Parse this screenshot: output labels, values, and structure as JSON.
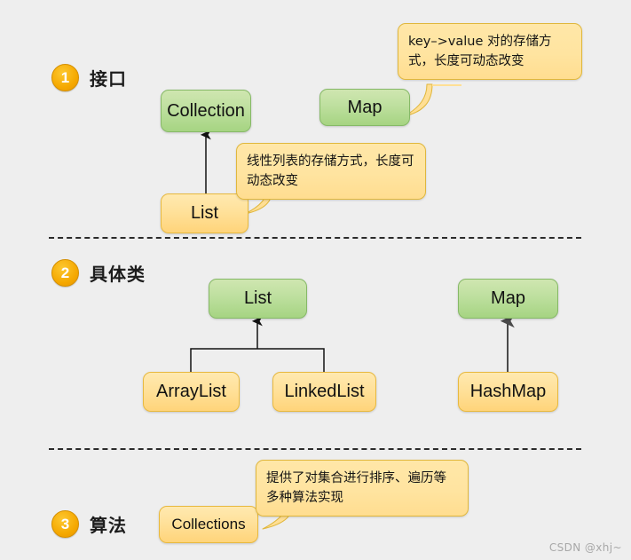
{
  "watermark": "CSDN @xhj~",
  "sections": [
    {
      "number": "1",
      "title": "接口"
    },
    {
      "number": "2",
      "title": "具体类"
    },
    {
      "number": "3",
      "title": "算法"
    }
  ],
  "nodes": {
    "collection": "Collection",
    "map_interface": "Map",
    "list_interface": "List",
    "list_class": "List",
    "map_class": "Map",
    "arraylist": "ArrayList",
    "linkedlist": "LinkedList",
    "hashmap": "HashMap",
    "collections": "Collections"
  },
  "callouts": {
    "map": "key–>value 对的存储方式，长度可动态改变",
    "list": "线性列表的存储方式，长度可动态改变",
    "collections": "提供了对集合进行排序、遍历等多种算法实现"
  },
  "colors": {
    "background": "#eeeeee",
    "green_fill": "#bfe0a0",
    "green_border": "#86b967",
    "yellow_fill": "#ffe19a",
    "yellow_border": "#e8b93f",
    "callout_fill": "#ffe4a0",
    "callout_border": "#e0b73c",
    "circle_fill": "#f5a800",
    "connector": "#1a1a1a",
    "arrow_gray": "#4a4a4a",
    "watermark": "#a8a8a8"
  }
}
